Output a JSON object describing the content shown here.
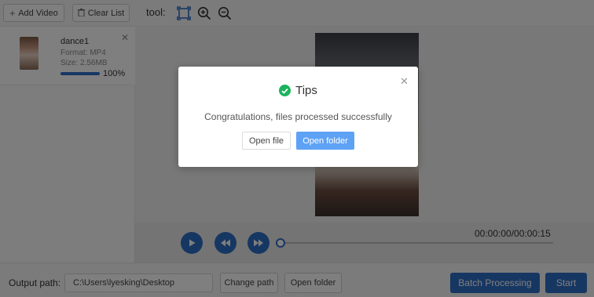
{
  "toolbar": {
    "add_video_label": "Add Video",
    "clear_list_label": "Clear List",
    "tool_label": "tool:"
  },
  "file_list": [
    {
      "name": "dance1",
      "format": "Format:  MP4",
      "size": "Size:  2.56MB",
      "progress": "100%",
      "progress_fraction": 1.0
    }
  ],
  "player": {
    "timecode": "00:00:00/00:00:15",
    "seek_fraction": 0.0
  },
  "output": {
    "label": "Output path:",
    "path_value": "C:\\Users\\lyesking\\Desktop",
    "change_path_label": "Change path",
    "open_folder_label": "Open folder",
    "batch_label": "Batch Processing",
    "start_label": "Start"
  },
  "dialog": {
    "title": "Tips",
    "message": "Congratulations, files processed successfully",
    "open_file_label": "Open file",
    "open_folder_label": "Open folder"
  },
  "colors": {
    "accent": "#2f6fc6",
    "dialog_primary": "#5ea2f5",
    "success": "#19b35c"
  },
  "icons": {
    "add": "plus-icon",
    "clear": "trash-icon",
    "crop": "crop-frame-icon",
    "zoom_in": "zoom-in-icon",
    "zoom_out": "zoom-out-icon",
    "close": "close-icon",
    "play": "play-icon",
    "rewind": "rewind-icon",
    "fast_forward": "fast-forward-icon",
    "success": "check-circle-icon"
  }
}
